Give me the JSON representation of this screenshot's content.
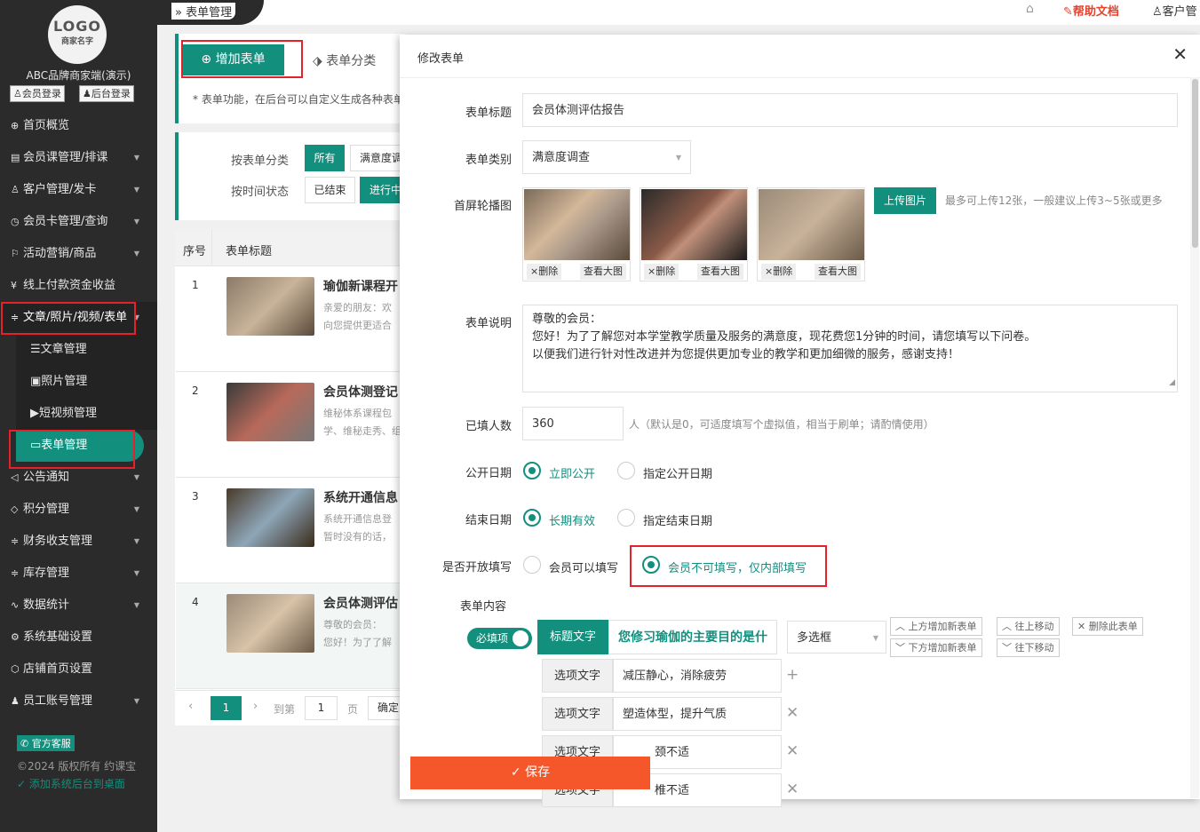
{
  "sidebar": {
    "logo_top": "LOGO",
    "logo_bottom": "商家名字",
    "brand": "ABC品牌商家端(演示)",
    "member_login": "会员登录",
    "admin_login": "后台登录",
    "items": [
      {
        "label": "首页概览",
        "icon": "globe-icon",
        "glyph": "⊕"
      },
      {
        "label": "会员课管理/排课",
        "icon": "document-icon",
        "glyph": "▤"
      },
      {
        "label": "客户管理/发卡",
        "icon": "user-icon",
        "glyph": "♙"
      },
      {
        "label": "会员卡管理/查询",
        "icon": "clock-icon",
        "glyph": "◷"
      },
      {
        "label": "活动营销/商品",
        "icon": "flag-icon",
        "glyph": "⚐"
      },
      {
        "label": "线上付款资金收益",
        "icon": "yen-icon",
        "glyph": "¥"
      },
      {
        "label": "文章/照片/视频/表单",
        "icon": "sliders-icon",
        "glyph": "≑"
      }
    ],
    "sub_items": [
      {
        "label": "文章管理",
        "glyph": "☰"
      },
      {
        "label": "照片管理",
        "glyph": "▣"
      },
      {
        "label": "短视频管理",
        "glyph": "▶"
      },
      {
        "label": "表单管理",
        "glyph": "▭"
      }
    ],
    "items_after": [
      {
        "label": "公告通知",
        "icon": "speaker-icon",
        "glyph": "◁"
      },
      {
        "label": "积分管理",
        "icon": "diamond-icon",
        "glyph": "◇"
      },
      {
        "label": "财务收支管理",
        "icon": "sliders-icon",
        "glyph": "≑"
      },
      {
        "label": "库存管理",
        "icon": "sliders-icon",
        "glyph": "≑"
      },
      {
        "label": "数据统计",
        "icon": "pulse-icon",
        "glyph": "∿"
      },
      {
        "label": "系统基础设置",
        "icon": "gear-icon",
        "glyph": "⚙"
      },
      {
        "label": "店铺首页设置",
        "icon": "cube-icon",
        "glyph": "⬡"
      },
      {
        "label": "员工账号管理",
        "icon": "person-icon",
        "glyph": "♟"
      }
    ],
    "official_service": "官方客服",
    "copyright": "©2024 版权所有 约课宝",
    "add_desktop": "添加系统后台到桌面"
  },
  "topbar": {
    "breadcrumb": "表单管理",
    "help_docs": "帮助文档",
    "customer": "客户管"
  },
  "toolbar": {
    "add_form": "增加表单",
    "form_category": "表单分类",
    "notice": "* 表单功能，在后台可以自定义生成各种表单"
  },
  "filters": {
    "by_category_label": "按表单分类",
    "category_all": "所有",
    "category_satisfaction": "满意度调",
    "by_time_label": "按时间状态",
    "time_ended": "已结束",
    "time_ongoing": "进行中"
  },
  "table": {
    "col_index": "序号",
    "col_title": "表单标题",
    "rows": [
      {
        "index": "1",
        "title": "瑜伽新课程开",
        "line1": "亲爱的朋友：欢",
        "line2": "向您提供更适合"
      },
      {
        "index": "2",
        "title": "会员体测登记",
        "line1": "维秘体系课程包",
        "line2": "学、维秘走秀、组"
      },
      {
        "index": "3",
        "title": "系统开通信息",
        "line1": "系统开通信息登",
        "line2": "暂时没有的话，"
      },
      {
        "index": "4",
        "title": "会员体测评估",
        "line1": "尊敬的会员：",
        "line2": "您好！为了了解"
      }
    ],
    "pager": {
      "current": "1",
      "goto_label": "到第",
      "page_input": "1",
      "page_unit": "页",
      "confirm": "确定"
    }
  },
  "modal": {
    "title": "修改表单",
    "fields": {
      "form_title_label": "表单标题",
      "form_title_value": "会员体测评估报告",
      "form_type_label": "表单类别",
      "form_type_value": "满意度调查",
      "carousel_label": "首屏轮播图",
      "delete_btn": "×删除",
      "view_btn": "查看大图",
      "upload_btn": "上传图片",
      "upload_hint": "最多可上传12张，一般建议上传3~5张或更多",
      "desc_label": "表单说明",
      "desc_line1": "尊敬的会员：",
      "desc_line2": "您好！为了了解您对本学堂教学质量及服务的满意度，现花费您1分钟的时间，请您填写以下问卷。",
      "desc_line3": "以便我们进行针对性改进并为您提供更加专业的教学和更加细微的服务，感谢支持！",
      "filled_label": "已填人数",
      "filled_value": "360",
      "filled_hint": "人（默认是0，可适度填写个虚拟值，相当于刷单；请酌情使用）",
      "publish_label": "公开日期",
      "publish_now": "立即公开",
      "publish_date": "指定公开日期",
      "end_label": "结束日期",
      "end_forever": "长期有效",
      "end_date": "指定结束日期",
      "open_label": "是否开放填写",
      "open_member": "会员可以填写",
      "open_internal": "会员不可填写，仅内部填写",
      "content_label": "表单内容"
    },
    "question": {
      "required": "必填项",
      "title_tag": "标题文字",
      "title_value": "您修习瑜伽的主要目的是什",
      "type_value": "多选框",
      "add_above": "上方增加新表单",
      "move_up": "往上移动",
      "delete": "删除此表单",
      "add_below": "下方增加新表单",
      "move_down": "往下移动",
      "option_label": "选项文字",
      "options": [
        "减压静心，消除疲劳",
        "塑造体型，提升气质",
        "颈不适",
        "椎不适"
      ]
    },
    "save": "保存"
  },
  "colors": {
    "accent": "#138f7e",
    "sidebar_bg": "#2b2b2b",
    "highlight": "#e8202a",
    "save": "#f5572a",
    "help": "#e8402a"
  }
}
